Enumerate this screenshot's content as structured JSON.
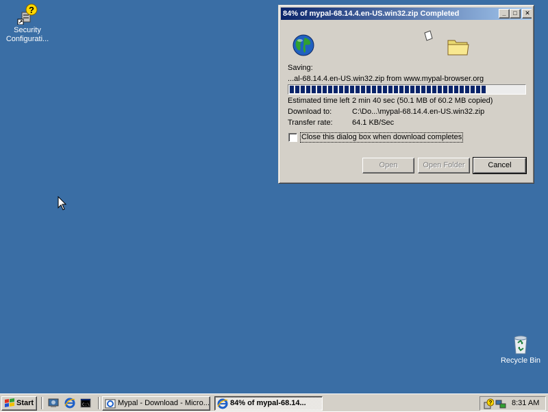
{
  "desktop": {
    "icons": [
      {
        "label": "Security Configurati..."
      },
      {
        "label": "Recycle Bin"
      }
    ]
  },
  "dialog": {
    "title": "84% of mypal-68.14.4.en-US.win32.zip Completed",
    "saving_label": "Saving:",
    "saving_source": "...al-68.14.4.en-US.win32.zip from www.mypal-browser.org",
    "progress_percent": 84,
    "rows": [
      {
        "key": "Estimated time left",
        "value": "2 min 40 sec (50.1 MB of 60.2 MB copied)"
      },
      {
        "key": "Download to:",
        "value": "C:\\Do...\\mypal-68.14.4.en-US.win32.zip"
      },
      {
        "key": "Transfer rate:",
        "value": "64.1 KB/Sec"
      }
    ],
    "close_checkbox_label": "Close this dialog box when download completes",
    "close_checkbox_checked": false,
    "buttons": {
      "open": "Open",
      "open_folder": "Open Folder",
      "cancel": "Cancel"
    },
    "title_buttons": {
      "min": "_",
      "max": "□",
      "close": "✕"
    }
  },
  "taskbar": {
    "start_label": "Start",
    "tasks": [
      {
        "label": "Mypal - Download - Micro...",
        "active": false
      },
      {
        "label": "84% of mypal-68.14...",
        "active": true
      }
    ],
    "clock": "8:31 AM"
  },
  "colors": {
    "desktop": "#3a6ea5",
    "titlebar_start": "#0a246a",
    "titlebar_end": "#a6caf0",
    "face": "#d4d0c8",
    "progress": "#0a246a"
  }
}
